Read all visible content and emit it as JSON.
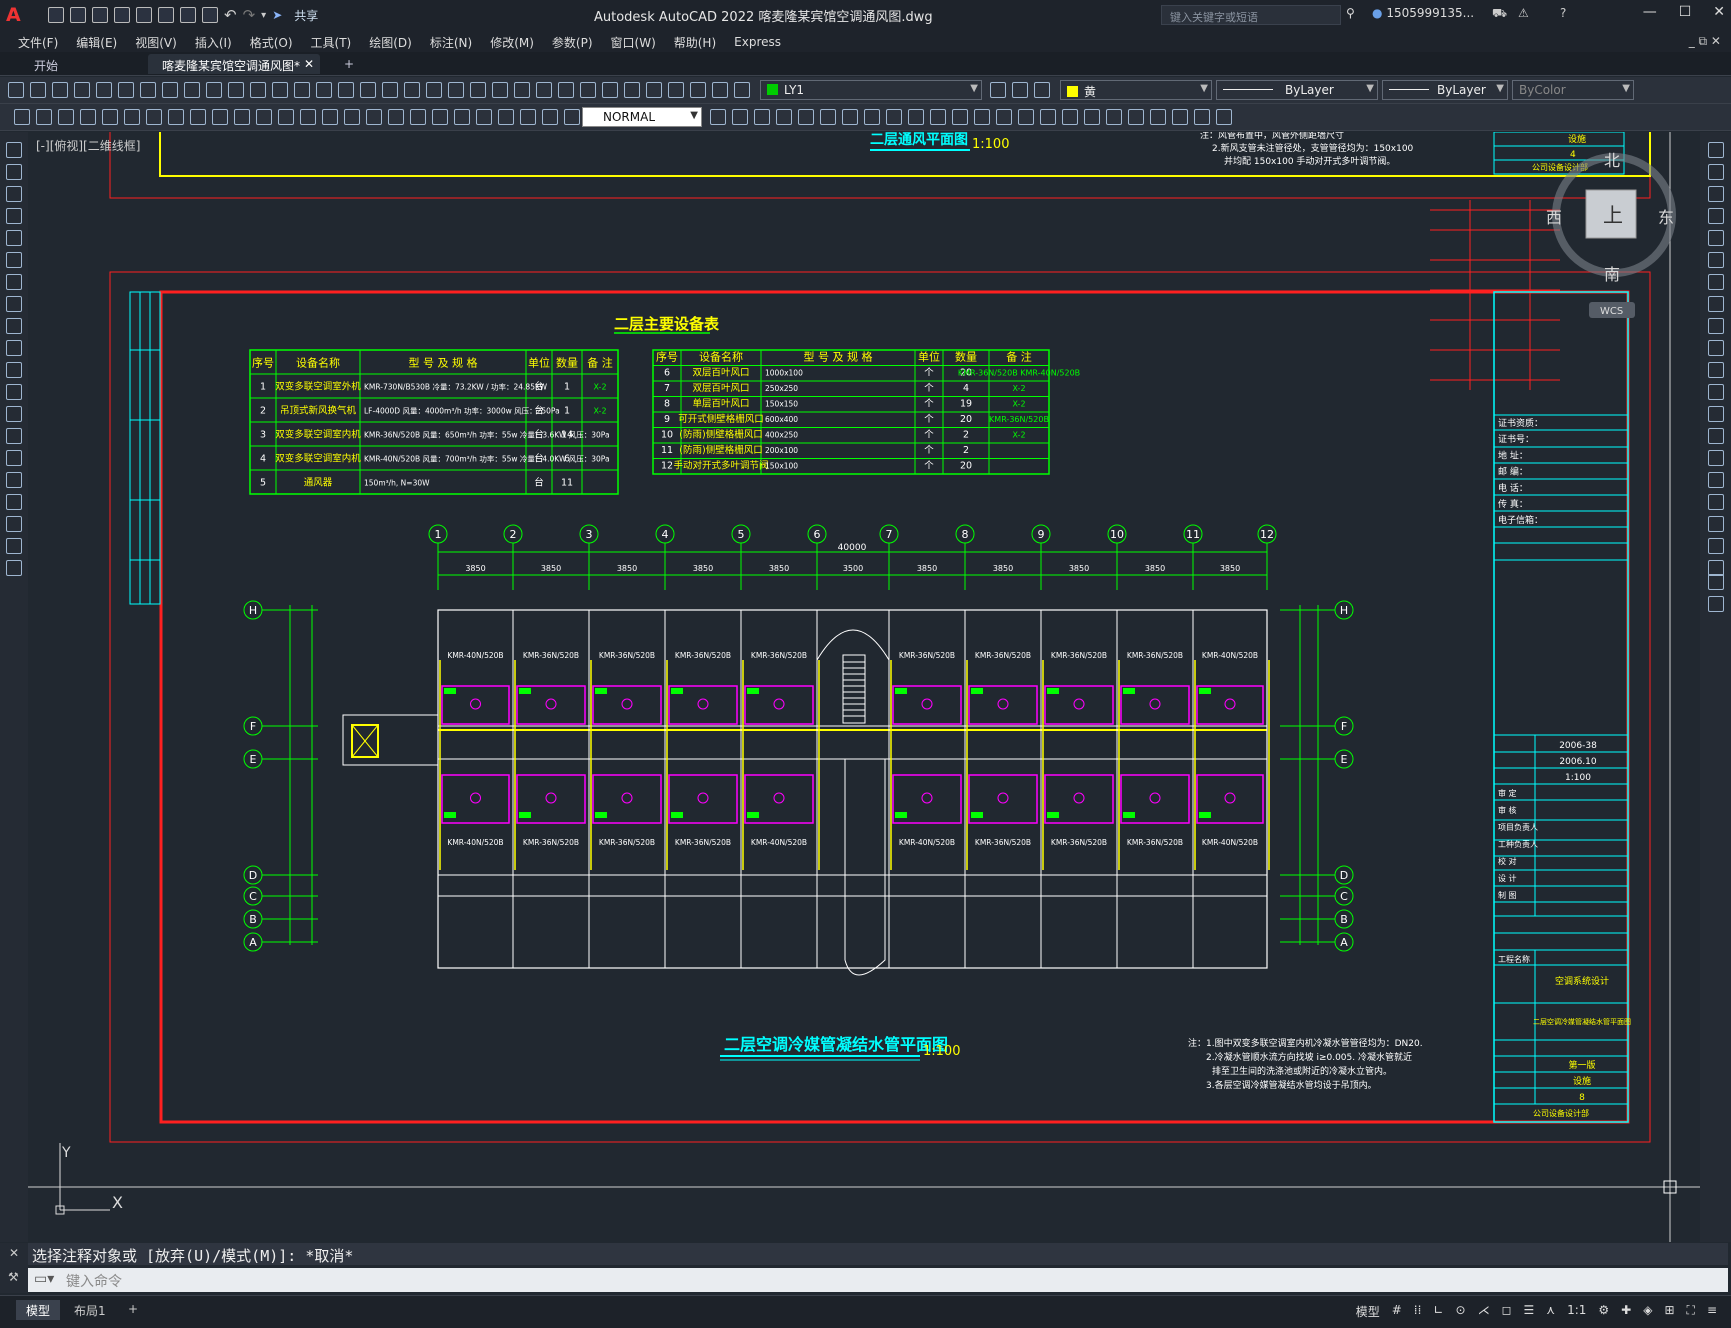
{
  "titlebar": {
    "window_title": "Autodesk AutoCAD 2022    喀麦隆某宾馆空调通风图.dwg",
    "share_label": "共享",
    "search_placeholder": "键入关键字或短语",
    "user": "1505999135..."
  },
  "menu": [
    "文件(F)",
    "编辑(E)",
    "视图(V)",
    "插入(I)",
    "格式(O)",
    "工具(T)",
    "绘图(D)",
    "标注(N)",
    "修改(M)",
    "参数(P)",
    "窗口(W)",
    "帮助(H)",
    "Express"
  ],
  "tabs": {
    "start": "开始",
    "doc": "喀麦隆某宾馆空调通风图*",
    "add": "+"
  },
  "toolbar": {
    "layer": "LY1",
    "color": "黄",
    "linetype": "ByLayer",
    "lineweight": "ByLayer",
    "plotstyle": "ByColor",
    "dimstyle": "NORMAL"
  },
  "viewport_label": "[-][俯视][二维线框]",
  "viewcube": {
    "north": "北",
    "south": "南",
    "east": "东",
    "west": "西",
    "top": "上",
    "wcs": "WCS"
  },
  "drawing": {
    "top_title": "二层通风平面图",
    "top_scale": "1:100",
    "table_title": "二层主要设备表",
    "table1_headers": [
      "序号",
      "设备名称",
      "型 号 及 规 格",
      "单位",
      "数量",
      "备 注"
    ],
    "table1_rows": [
      [
        "1",
        "双变多联空调室外机",
        "KMR-730N/B530B  冷量：73.2KW / 功率：24.85KW",
        "台",
        "1",
        "X-2"
      ],
      [
        "2",
        "吊顶式新风换气机",
        "LF-4000D 风量：4000m³/h 功率：3000w 风压：250Pa",
        "台",
        "1",
        "X-2"
      ],
      [
        "3",
        "双变多联空调室内机",
        "KMR-36N/520B 风量：650m³/h 功率：55w 冷量：3.6KW 风压：30Pa",
        "台",
        "14",
        ""
      ],
      [
        "4",
        "双变多联空调室内机",
        "KMR-40N/520B 风量：700m³/h 功率：55w 冷量：4.0KW 风压：30Pa",
        "台",
        "6",
        ""
      ],
      [
        "5",
        "通风器",
        "150m³/h, N=30W",
        "台",
        "11",
        ""
      ]
    ],
    "table2_headers": [
      "序号",
      "设备名称",
      "型 号 及 规 格",
      "单位",
      "数量",
      "备 注"
    ],
    "table2_rows": [
      [
        "6",
        "双层百叶风口",
        "1000x100",
        "个",
        "20",
        "KMR-36N/520B KMR-40N/520B"
      ],
      [
        "7",
        "双层百叶风口",
        "250x250",
        "个",
        "4",
        "X-2"
      ],
      [
        "8",
        "单层百叶风口",
        "150x150",
        "个",
        "19",
        "X-2"
      ],
      [
        "9",
        "可开式侧壁格栅风口",
        "600x400",
        "个",
        "20",
        "KMR-36N/520B"
      ],
      [
        "10",
        "(防雨)侧壁格栅风口",
        "400x250",
        "个",
        "2",
        "X-2"
      ],
      [
        "11",
        "(防雨)侧壁格栅风口",
        "200x100",
        "个",
        "2",
        ""
      ],
      [
        "12",
        "手动对开式多叶调节阀",
        "150x100",
        "个",
        "20",
        ""
      ]
    ],
    "axes_top": [
      "1",
      "2",
      "3",
      "4",
      "5",
      "6",
      "7",
      "8",
      "9",
      "10",
      "11",
      "12"
    ],
    "axes_side": [
      "H",
      "F",
      "E",
      "D",
      "C",
      "B",
      "A"
    ],
    "dims": [
      "3850",
      "3850",
      "3850",
      "3850",
      "3850",
      "3500",
      "3850",
      "3850",
      "3850",
      "3850",
      "3850"
    ],
    "total_dim": "40000",
    "unit_top": [
      "KMR-40N/520B",
      "KMR-36N/520B",
      "KMR-36N/520B",
      "KMR-36N/520B",
      "KMR-36N/520B",
      "KMR-36N/520B",
      "KMR-36N/520B",
      "KMR-36N/520B",
      "KMR-36N/520B",
      "KMR-40N/520B"
    ],
    "unit_bottom": [
      "KMR-40N/520B",
      "KMR-36N/520B",
      "KMR-36N/520B",
      "KMR-36N/520B",
      "KMR-40N/520B",
      "KMR-40N/520B",
      "KMR-36N/520B",
      "KMR-36N/520B",
      "KMR-36N/520B",
      "KMR-40N/520B"
    ],
    "plan_title": "二层空调冷媒管凝结水管平面图",
    "plan_scale": "1:100",
    "notes": [
      "注：1.图中双变多联空调室内机冷凝水管管径均为：DN20.",
      "2.冷凝水管顺水流方向找坡 i≥0.005. 冷凝水管就近",
      "排至卫生间的洗涤池或附近的冷凝水立管内。",
      "3.各层空调冷媒管凝结水管均设于吊顶内。"
    ],
    "top_notes": [
      "注：风管布置中，风管外侧距墙尺寸",
      "2.新风支管未注管径处，支管管径均为：150x100",
      "并均配 150x100 手动对开式多叶调节阀。"
    ],
    "titleblock": {
      "labels": [
        "证书资质：",
        "证书号：",
        "地  址：",
        "邮  编：",
        "电  话：",
        "传  真：",
        "电子信箱："
      ],
      "design_no": "2006-38",
      "date": "2006.10",
      "scale": "1:100",
      "roles": [
        "审  定",
        "审  核",
        "项目负责人",
        "工种负责人",
        "校  对",
        "设  计",
        "制  图"
      ],
      "project": "工程名称",
      "unit_name": "空调系统设计",
      "drawing_name": "二层空调冷媒管凝结水管平面图",
      "version": "第一版",
      "sheet_type": "设施",
      "sheet_no": "8",
      "company": "公司设备设计部",
      "top_no": "4",
      "top_type": "设施"
    },
    "ucs": {
      "y": "Y",
      "x": "X"
    }
  },
  "command": {
    "history": "选择注释对象或 [放弃(U)/模式(M)]: *取消*",
    "placeholder": "键入命令"
  },
  "status": {
    "model_tab": "模型",
    "layout_tab": "布局1",
    "add": "+",
    "model_label": "模型",
    "scale": "1:1"
  }
}
